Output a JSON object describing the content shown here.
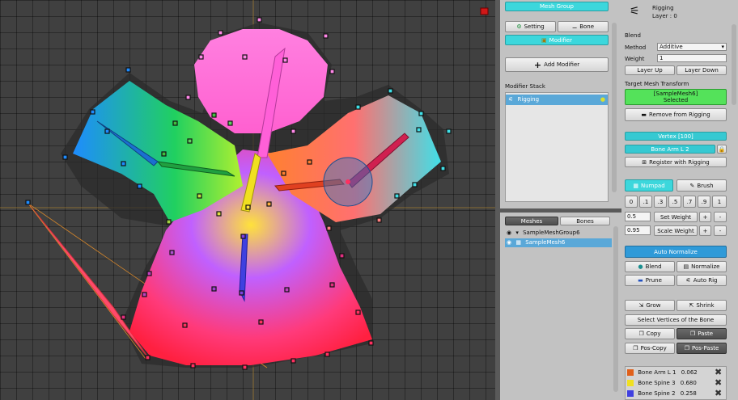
{
  "mesh_group_panel": {
    "title": "Mesh Group",
    "setting_label": "Setting",
    "bone_label": "Bone",
    "modifier_tab_label": "Modifier",
    "add_modifier_label": "Add Modifier",
    "modifier_stack_label": "Modifier Stack",
    "modifier_items": [
      {
        "label": "Rigging"
      }
    ]
  },
  "hierarchy": {
    "tab_meshes": "Meshes",
    "tab_bones": "Bones",
    "group_label": "SampleMeshGroup6",
    "mesh_label": "SampleMesh6"
  },
  "inspector": {
    "title": "Rigging",
    "layer": "Layer : 0",
    "blend_label": "Blend",
    "method_label": "Method",
    "method_value": "Additive",
    "weight_label": "Weight",
    "weight_value": "1",
    "layer_up": "Layer Up",
    "layer_down": "Layer Down",
    "target_label": "Target Mesh Transform",
    "target_name": "[SampleMesh6]",
    "target_state": "Selected",
    "remove_label": "Remove from Rigging",
    "vertex_label": "Vertex [100]",
    "bone_name": "Bone Arm L 2",
    "register_label": "Register with Rigging",
    "numpad_label": "Numpad",
    "brush_label": "Brush",
    "numpad_values": [
      "0",
      ".1",
      ".3",
      ".5",
      ".7",
      ".9",
      "1"
    ],
    "set_weight_value": "0.5",
    "set_weight_label": "Set Weight",
    "scale_weight_value": "0.95",
    "scale_weight_label": "Scale Weight",
    "plus": "+",
    "minus": "-",
    "auto_normalize": "Auto Normalize",
    "blend_btn": "Blend",
    "normalize_btn": "Normalize",
    "prune_btn": "Prune",
    "auto_rig_btn": "Auto Rig",
    "grow_btn": "Grow",
    "shrink_btn": "Shrink",
    "select_vertices": "Select Vertices of the Bone",
    "copy_btn": "Copy",
    "paste_btn": "Paste",
    "pos_copy_btn": "Pos-Copy",
    "pos_paste_btn": "Pos-Paste",
    "weights": [
      {
        "name": "Bone Arm L 1",
        "value": "0.062",
        "color": "#e0601a"
      },
      {
        "name": "Bone Spine 3",
        "value": "0.680",
        "color": "#f0e020"
      },
      {
        "name": "Bone Spine 2",
        "value": "0.258",
        "color": "#4040e0"
      }
    ]
  },
  "colors": {
    "accent_cyan": "#3cd7dc",
    "selection_blue": "#5aa8d8",
    "selected_green": "#54e25a",
    "guide_line": "#b88a3a"
  }
}
